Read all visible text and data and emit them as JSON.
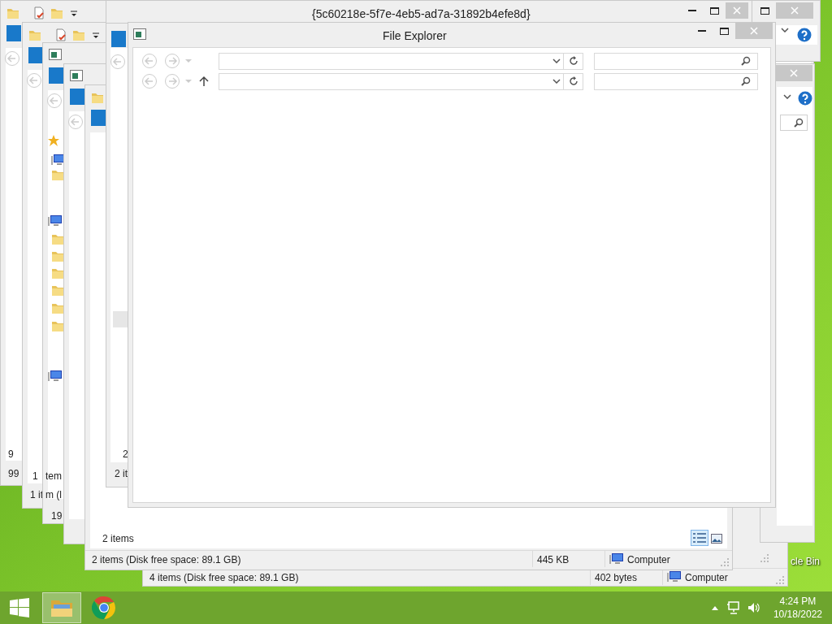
{
  "desktop_icons": [
    {
      "label": "cle Bin"
    }
  ],
  "windows": [
    {
      "kind": "status_only",
      "status": [
        "4 items (Disk free space: 89.1 GB)",
        "402 bytes",
        "Computer"
      ]
    },
    {
      "kind": "stack",
      "fragments": [
        "9",
        "99"
      ]
    },
    {
      "kind": "stack",
      "fragments": [
        "1",
        "1 it"
      ]
    },
    {
      "kind": "stack",
      "fragments": [
        "tem",
        "m (l",
        "19"
      ]
    },
    {
      "kind": "stack"
    },
    {
      "kind": "titled",
      "title": "{5c60218e-5f7e-4eb5-ad7a-31892b4efe8d}"
    },
    {
      "kind": "folder_view",
      "item_count": "2 items",
      "status": [
        "2 items (Disk free space: 89.1 GB)",
        "445 KB",
        "Computer"
      ]
    },
    {
      "kind": "panel",
      "fragments": [
        "2",
        "2 it"
      ]
    },
    {
      "kind": "corner"
    },
    {
      "kind": "edge"
    },
    {
      "kind": "explorer",
      "title": "File Explorer",
      "nav_rows": [
        {
          "up_button": false
        },
        {
          "up_button": true
        }
      ]
    }
  ],
  "taskbar": {
    "pinned": [
      {
        "kind": "explorer",
        "selected": true
      },
      {
        "kind": "browser",
        "selected": false
      }
    ],
    "time": "4:24 PM",
    "date": "10/18/2022"
  }
}
